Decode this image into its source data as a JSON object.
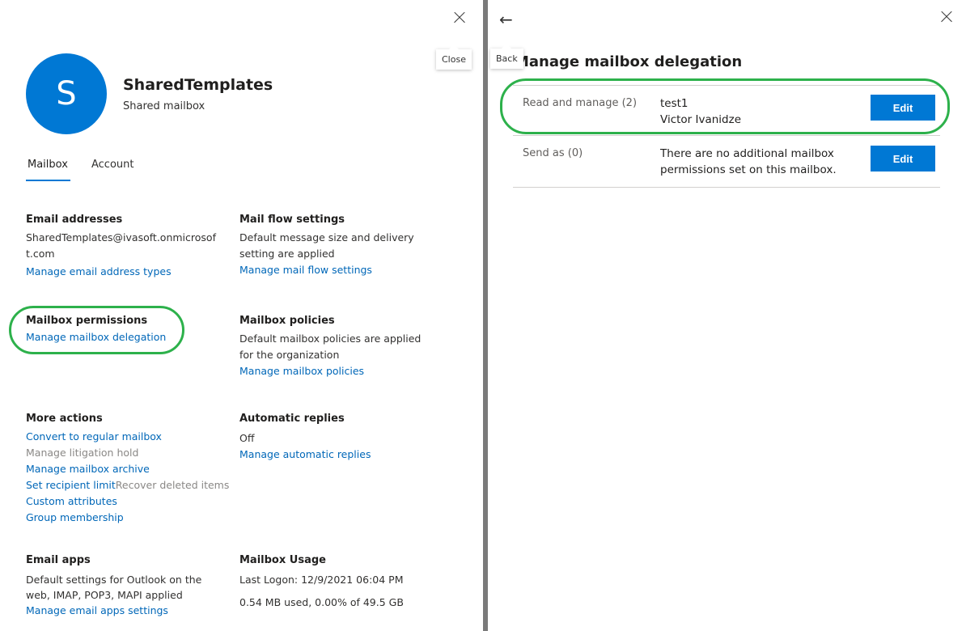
{
  "left_panel": {
    "close_tooltip": "Close",
    "avatar_initial": "S",
    "name": "SharedTemplates",
    "type": "Shared mailbox",
    "tabs": [
      {
        "label": "Mailbox",
        "active": true
      },
      {
        "label": "Account",
        "active": false
      }
    ],
    "sections": {
      "email": {
        "title": "Email addresses",
        "text": "SharedTemplates@ivasoft.onmicrosoft.com",
        "link": "Manage email address types"
      },
      "mailflow": {
        "title": "Mail flow settings",
        "text": "Default message size and delivery setting are applied",
        "link": "Manage mail flow settings"
      },
      "permissions": {
        "title": "Mailbox permissions",
        "link": "Manage mailbox delegation"
      },
      "policies": {
        "title": "Mailbox policies",
        "text": "Default mailbox policies are applied for the organization",
        "link": "Manage mailbox policies"
      },
      "more": {
        "title": "More actions",
        "items": [
          "Convert to regular mailbox",
          "Manage litigation hold",
          "Manage mailbox archive",
          "Set recipient limit",
          "Recover deleted items",
          "Custom attributes",
          "Group membership"
        ]
      },
      "autoreply": {
        "title": "Automatic replies",
        "text": "Off",
        "link": "Manage automatic replies"
      },
      "apps": {
        "title": "Email apps",
        "text": "Default settings for Outlook on the web, IMAP, POP3, MAPI applied",
        "link": "Manage email apps settings"
      },
      "usage": {
        "title": "Mailbox Usage",
        "last_logon": "Last Logon: 12/9/2021 06:04 PM",
        "used": "0.54 MB used, 0.00% of 49.5 GB"
      }
    }
  },
  "right_panel": {
    "back_tooltip": "Back",
    "heading": "Manage mailbox delegation",
    "rows": [
      {
        "label": "Read and manage (2)",
        "values": [
          "test1",
          "Victor Ivanidze"
        ],
        "button": "Edit"
      },
      {
        "label": "Send as (0)",
        "values": [
          "There are no additional mailbox permissions set on this mailbox."
        ],
        "button": "Edit"
      }
    ]
  },
  "colors": {
    "accent": "#0078d4",
    "highlight": "#2db14b"
  }
}
